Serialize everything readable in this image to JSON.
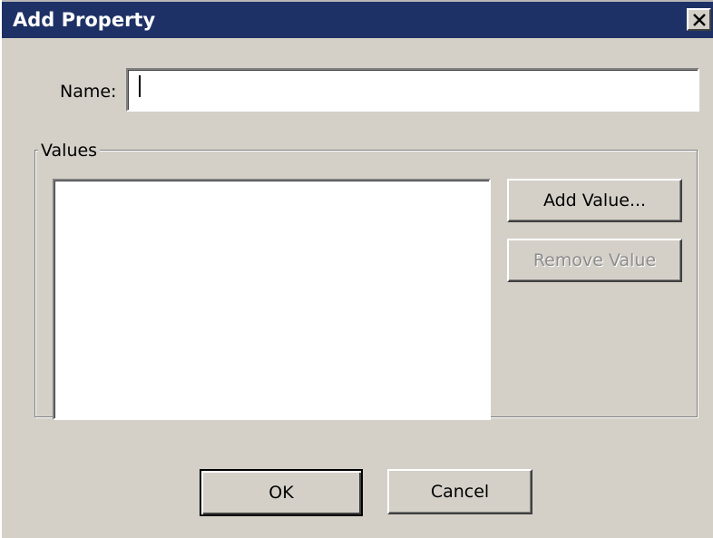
{
  "window": {
    "title": "Add Property",
    "close_icon": "close-icon"
  },
  "form": {
    "name_label": "Name:",
    "name_value": "",
    "values_group_label": "Values",
    "values_list_items": []
  },
  "buttons": {
    "add_value": "Add Value...",
    "remove_value": "Remove Value",
    "ok": "OK",
    "cancel": "Cancel"
  },
  "colors": {
    "titlebar": "#1e3166",
    "dialog_background": "#d4d0c8",
    "disabled_text": "#8c8c8c"
  }
}
